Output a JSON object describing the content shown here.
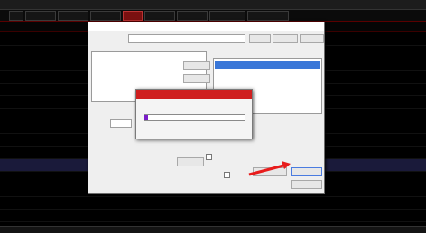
{
  "window": {
    "title": ""
  },
  "menu": {
    "items": [
      "",
      "",
      "",
      "",
      "",
      "",
      "",
      "",
      ""
    ]
  },
  "header": {
    "columns": [
      "",
      "",
      "",
      "",
      "",
      "",
      "",
      "",
      "",
      "",
      "",
      "",
      "",
      "",
      "",
      "",
      "",
      "",
      "",
      ""
    ]
  },
  "rows": [
    {
      "id": "",
      "name": "",
      "c3": "",
      "c4": "",
      "c5": "",
      "c6": "",
      "c7": "",
      "c8": "",
      "c9": "",
      "c10": "",
      "c11": "",
      "c12": "",
      "c13": "",
      "c14": "",
      "c15": "",
      "c16": "",
      "c17": "",
      "c18": ""
    },
    {
      "id": "",
      "name": "",
      "c3": "",
      "c4": "",
      "c5": "",
      "c6": "",
      "c7": "",
      "c8": "",
      "c9": "",
      "c10": "",
      "c11": "",
      "c12": "",
      "c13": "",
      "c14": "",
      "c15": "",
      "c16": "",
      "c17": "",
      "c18": ""
    },
    {
      "id": "",
      "name": "",
      "c3": "",
      "c4": "",
      "c5": "",
      "c6": "",
      "c7": "",
      "c8": "",
      "c9": "",
      "c10": "",
      "c11": "",
      "c12": "",
      "c13": "",
      "c14": "",
      "c15": "",
      "c16": "",
      "c17": "",
      "c18": ""
    },
    {
      "id": "",
      "name": "",
      "c3": "",
      "c4": "",
      "c5": "",
      "c6": "",
      "c7": "",
      "c8": "",
      "c9": "",
      "c10": "",
      "c11": "",
      "c12": "",
      "c13": "",
      "c14": "",
      "c15": "",
      "c16": "",
      "c17": "",
      "c18": ""
    },
    {
      "id": "",
      "name": "",
      "c3": "",
      "c4": "",
      "c5": "",
      "c6": "",
      "c7": "",
      "c8": "",
      "c9": "",
      "c10": "",
      "c11": "",
      "c12": "",
      "c13": "",
      "c14": "",
      "c15": "",
      "c16": "",
      "c17": "",
      "c18": ""
    },
    {
      "id": "",
      "name": "",
      "c3": "",
      "c4": "",
      "c5": "",
      "c6": "",
      "c7": "",
      "c8": "",
      "c9": "",
      "c10": "",
      "c11": "",
      "c12": "",
      "c13": "",
      "c14": "",
      "c15": "",
      "c16": "",
      "c17": "",
      "c18": ""
    },
    {
      "id": "",
      "name": "",
      "c3": "",
      "c4": "",
      "c5": "",
      "c6": "",
      "c7": "",
      "c8": "",
      "c9": "",
      "c10": "",
      "c11": "",
      "c12": "",
      "c13": "",
      "c14": "",
      "c15": "",
      "c16": "",
      "c17": "",
      "c18": ""
    },
    {
      "id": "",
      "name": "",
      "c3": "",
      "c4": "",
      "c5": "",
      "c6": "",
      "c7": "",
      "c8": "",
      "c9": "",
      "c10": "",
      "c11": "",
      "c12": "",
      "c13": "",
      "c14": "",
      "c15": "",
      "c16": "",
      "c17": "",
      "c18": ""
    },
    {
      "id": "",
      "name": "",
      "c3": "",
      "c4": "",
      "c5": "",
      "c6": "",
      "c7": "",
      "c8": "",
      "c9": "",
      "c10": "",
      "c11": "",
      "c12": "",
      "c13": "",
      "c14": "",
      "c15": "",
      "c16": "",
      "c17": "",
      "c18": ""
    },
    {
      "id": "",
      "name": "",
      "c3": "",
      "c4": "",
      "c5": "",
      "c6": "",
      "c7": "",
      "c8": "",
      "c9": "",
      "c10": "",
      "c11": "",
      "c12": "",
      "c13": "",
      "c14": "",
      "c15": "",
      "c16": "",
      "c17": "",
      "c18": ""
    },
    {
      "id": "",
      "name": "",
      "c3": "",
      "c4": "",
      "c5": "",
      "c6": "",
      "c7": "",
      "c8": "",
      "c9": "",
      "c10": "",
      "c11": "",
      "c12": "",
      "c13": "",
      "c14": "",
      "c15": "",
      "c16": "",
      "c17": "",
      "c18": ""
    },
    {
      "id": "",
      "name": "",
      "c3": "",
      "c4": "",
      "c5": "",
      "c6": "",
      "c7": "",
      "c8": "",
      "c9": "",
      "c10": "",
      "c11": "",
      "c12": "",
      "c13": "",
      "c14": "",
      "c15": "",
      "c16": "",
      "c17": "",
      "c18": ""
    },
    {
      "id": "",
      "name": "",
      "c3": "",
      "c4": "",
      "c5": "",
      "c6": "",
      "c7": "",
      "c8": "",
      "c9": "",
      "c10": "",
      "c11": "",
      "c12": "",
      "c13": "",
      "c14": "",
      "c15": "",
      "c16": "",
      "c17": "",
      "c18": ""
    },
    {
      "id": "",
      "name": "",
      "c3": "",
      "c4": "",
      "c5": "",
      "c6": "",
      "c7": "",
      "c8": "",
      "c9": "",
      "c10": "",
      "c11": "",
      "c12": "",
      "c13": "",
      "c14": "",
      "c15": "",
      "c16": "",
      "c17": "",
      "c18": ""
    },
    {
      "id": "",
      "name": "",
      "c3": "",
      "c4": "",
      "c5": "",
      "c6": "",
      "c7": "",
      "c8": "",
      "c9": "",
      "c10": "",
      "c11": "",
      "c12": "",
      "c13": "",
      "c14": "",
      "c15": "",
      "c16": "",
      "c17": "",
      "c18": ""
    }
  ],
  "dialog": {
    "title": "",
    "formula_label": "",
    "formula_value": "",
    "btn_formula_list": "",
    "btn_use_desc": "",
    "btn_save_cond": "",
    "calc_param_label": "",
    "first_time_label": "",
    "btn_add_cond": "",
    "btn_delete_cond": "",
    "cond_list_header": "",
    "cond_list_items": [
      ""
    ],
    "hint_red": "",
    "period_label": "",
    "period_value": "",
    "data_range_label": "",
    "data_range_value": "",
    "btn_change_range": "",
    "full_label": "",
    "full_value": "",
    "chk_prev_pick": "",
    "chk_new_list": "",
    "btn_add_block": "",
    "btn_execute_pick": "",
    "btn_stop": "",
    "progress": {
      "title": "",
      "message": "",
      "fraction": 0.04
    }
  },
  "annotation": {
    "line1": "",
    "line2": ""
  },
  "colors": {
    "up": "#ff4a4a",
    "down": "#3fd25a",
    "code": "#e6d84a",
    "accent": "#cf1f1f",
    "progress_fill": "#7a1ec8",
    "annotation": "#ffa82a",
    "arrow": "#e81c1c"
  }
}
